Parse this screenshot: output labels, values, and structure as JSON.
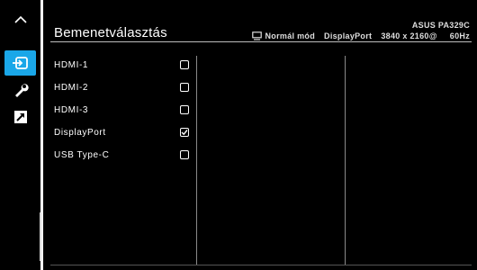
{
  "sidebar": {
    "items": [
      {
        "icon": "chevron-up-icon",
        "active": false
      },
      {
        "icon": "input-select-icon",
        "active": true
      },
      {
        "icon": "wrench-icon",
        "active": false
      },
      {
        "icon": "shortcut-arrow-icon",
        "active": false
      }
    ]
  },
  "header": {
    "title": "Bemenetválasztás",
    "model": "ASUS PA329C",
    "mode": "Normál mód",
    "input": "DisplayPort",
    "resolution": "3840 x 2160@",
    "refresh": "60Hz"
  },
  "menu": {
    "items": [
      {
        "label": "HDMI-1",
        "checked": false
      },
      {
        "label": "HDMI-2",
        "checked": false
      },
      {
        "label": "HDMI-3",
        "checked": false
      },
      {
        "label": "DisplayPort",
        "checked": true
      },
      {
        "label": "USB Type-C",
        "checked": false
      }
    ]
  },
  "colors": {
    "accent": "#1aa7e8",
    "background": "#000000",
    "text": "#ffffff"
  }
}
